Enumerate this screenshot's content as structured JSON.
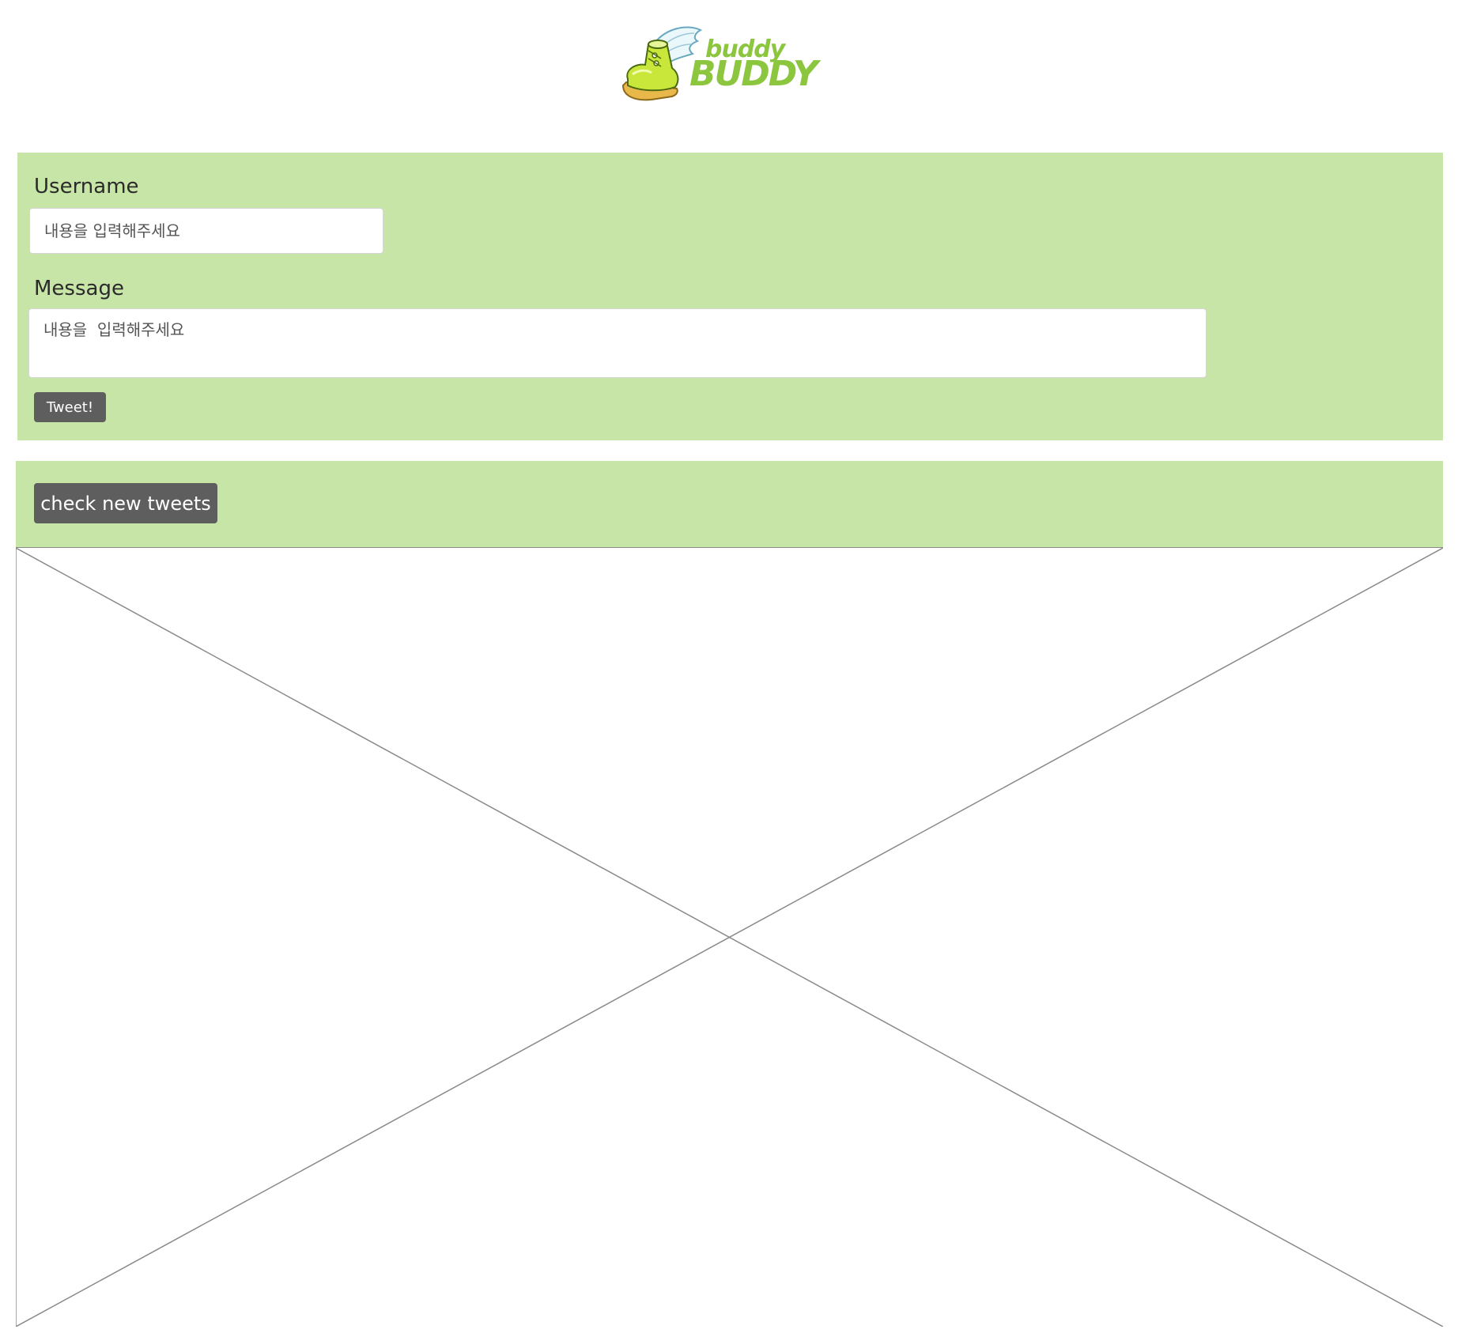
{
  "brand": {
    "small": "buddy",
    "big": "BUDDY",
    "color": "#8cc63f"
  },
  "form": {
    "username_label": "Username",
    "username_placeholder": "내용을 입력해주세요",
    "message_label": "Message",
    "message_placeholder": "내용을  입력해주세요",
    "submit_label": "Tweet!"
  },
  "feed": {
    "check_label": "check new tweets",
    "panel_color": "#c8e5a8",
    "button_color": "#5e5e5e"
  }
}
